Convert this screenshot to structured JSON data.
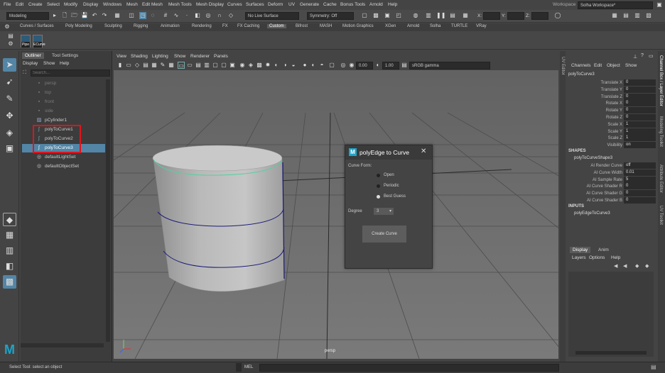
{
  "menubar": {
    "items": [
      "File",
      "Edit",
      "Create",
      "Select",
      "Modify",
      "Display",
      "Windows",
      "Mesh",
      "Edit Mesh",
      "Mesh Tools",
      "Mesh Display",
      "Curves",
      "Surfaces",
      "Deform",
      "UV",
      "Generate",
      "Cache",
      "Bonus Tools",
      "Arnold",
      "Help"
    ],
    "workspace_label": "Workspace :",
    "workspace_value": "Solha Workspace*"
  },
  "toolbar": {
    "mode": "Modeling",
    "live_surface": "No Live Surface",
    "symmetry": "Symmetry: Off",
    "x_label": "X:",
    "y_label": "Y:",
    "z_label": "Z:"
  },
  "shelf": {
    "tabs": [
      "Curves / Surfaces",
      "Poly Modeling",
      "Sculpting",
      "Rigging",
      "Animation",
      "Rendering",
      "FX",
      "FX Caching",
      "Custom",
      "Bifrost",
      "MASH",
      "Motion Graphics",
      "XGen",
      "Arnold",
      "Solha",
      "TURTLE",
      "VRay"
    ],
    "active_tab": "Custom",
    "buttons": [
      "Pipe",
      "ECurve"
    ]
  },
  "outliner": {
    "tabs": [
      "Outliner",
      "Tool Settings"
    ],
    "menu": [
      "Display",
      "Show",
      "Help"
    ],
    "search_placeholder": "Search...",
    "rows": [
      "persp",
      "top",
      "front",
      "side",
      "pCylinder1",
      "polyToCurve1",
      "polyToCurve2",
      "polyToCurve3",
      "defaultLightSet",
      "defaultObjectSet"
    ]
  },
  "viewport": {
    "menu": [
      "View",
      "Shading",
      "Lighting",
      "Show",
      "Renderer",
      "Panels"
    ],
    "exposure": "0.00",
    "gamma": "1.00",
    "colorspace": "sRGB gamma",
    "camera_label": "persp"
  },
  "dialog": {
    "title": "polyEdge to Curve",
    "form_label": "Curve Form:",
    "options": [
      "Open",
      "Periodic",
      "Best Guess"
    ],
    "selected_option": "Best Guess",
    "degree_label": "Degree",
    "degree_value": "3",
    "button": "Create Curve"
  },
  "channelbox": {
    "menu": [
      "Channels",
      "Edit",
      "Object",
      "Show"
    ],
    "node": "polyToCurve3",
    "attrs": [
      {
        "label": "Translate X",
        "value": "0"
      },
      {
        "label": "Translate Y",
        "value": "0"
      },
      {
        "label": "Translate Z",
        "value": "0"
      },
      {
        "label": "Rotate X",
        "value": "0"
      },
      {
        "label": "Rotate Y",
        "value": "0"
      },
      {
        "label": "Rotate Z",
        "value": "0"
      },
      {
        "label": "Scale X",
        "value": "1"
      },
      {
        "label": "Scale Y",
        "value": "1"
      },
      {
        "label": "Scale Z",
        "value": "1"
      },
      {
        "label": "Visibility",
        "value": "on"
      }
    ],
    "shapes_header": "SHAPES",
    "shape_node": "polyToCurveShape3",
    "shape_attrs": [
      {
        "label": "AI Render Curve",
        "value": "off"
      },
      {
        "label": "AI Curve Width",
        "value": "0.01"
      },
      {
        "label": "AI Sample Rate",
        "value": "5"
      },
      {
        "label": "AI Curve Shader R",
        "value": "0"
      },
      {
        "label": "AI Curve Shader G",
        "value": "0"
      },
      {
        "label": "AI Curve Shader B",
        "value": "0"
      }
    ],
    "inputs_header": "INPUTS",
    "input_node": "polyEdgeToCurve3"
  },
  "layers": {
    "tabs": [
      "Display",
      "Anim"
    ],
    "menu": [
      "Layers",
      "Options",
      "Help"
    ]
  },
  "side_tabs": [
    "Channel Box / Layer Editor",
    "Modeling Toolkit",
    "Attribute Editor",
    "UV Toolkit"
  ],
  "left_side_tab": "UV Editor",
  "status": {
    "help_line": "Select Tool: select an object",
    "mel_label": "MEL"
  },
  "colors": {
    "selection": "#5285a6",
    "highlight_box": "#e0141e",
    "curve_selected": "#4fd3a0",
    "curve_blue": "#1a1a7a"
  }
}
